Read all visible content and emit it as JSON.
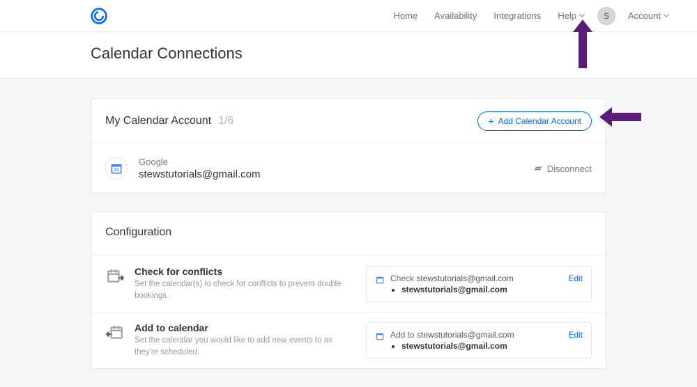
{
  "nav": {
    "home": "Home",
    "availability": "Availability",
    "integrations": "Integrations",
    "help": "Help",
    "account": "Account",
    "avatar_initial": "S"
  },
  "page": {
    "title": "Calendar Connections"
  },
  "calendar_account": {
    "title": "My Calendar Account",
    "count": "1/6",
    "add_label": "Add Calendar Account",
    "provider": "Google",
    "email": "stewstutorials@gmail.com",
    "disconnect_label": "Disconnect"
  },
  "configuration": {
    "title": "Configuration",
    "conflicts": {
      "title": "Check for conflicts",
      "subtitle": "Set the calendar(s) to check for conflicts to prevent double bookings.",
      "summary_prefix": "Check ",
      "summary_email": "stewstutorials@gmail.com",
      "summary_item": "stewstutorials@gmail.com",
      "edit": "Edit"
    },
    "add_to_calendar": {
      "title": "Add to calendar",
      "subtitle": "Set the calendar you would like to add new events to as they're scheduled.",
      "summary_prefix": "Add to ",
      "summary_email": "stewstutorials@gmail.com",
      "summary_item": "stewstutorials@gmail.com",
      "edit": "Edit"
    }
  }
}
